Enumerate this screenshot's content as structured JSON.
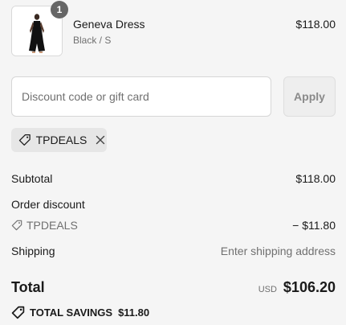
{
  "product": {
    "quantity": "1",
    "name": "Geneva Dress",
    "variant": "Black / S",
    "price": "$118.00",
    "image_icon": "dress-product-photo"
  },
  "discount": {
    "placeholder": "Discount code or gift card",
    "apply_label": "Apply",
    "applied_code": "TPDEALS",
    "tag_icon": "tag-icon",
    "remove_icon": "close-icon"
  },
  "summary": {
    "subtotal_label": "Subtotal",
    "subtotal_value": "$118.00",
    "order_discount_label": "Order discount",
    "discount_code": "TPDEALS",
    "discount_value": "− $11.80",
    "shipping_label": "Shipping",
    "shipping_value": "Enter shipping address",
    "total_label": "Total",
    "currency": "USD",
    "total_value": "$106.20",
    "savings_label": "TOTAL SAVINGS",
    "savings_value": "$11.80"
  },
  "colors": {
    "background": "#f5f5f5",
    "text": "#1a1a1a",
    "muted": "#707070",
    "badge": "#666666",
    "chip": "#e6e6e6"
  }
}
